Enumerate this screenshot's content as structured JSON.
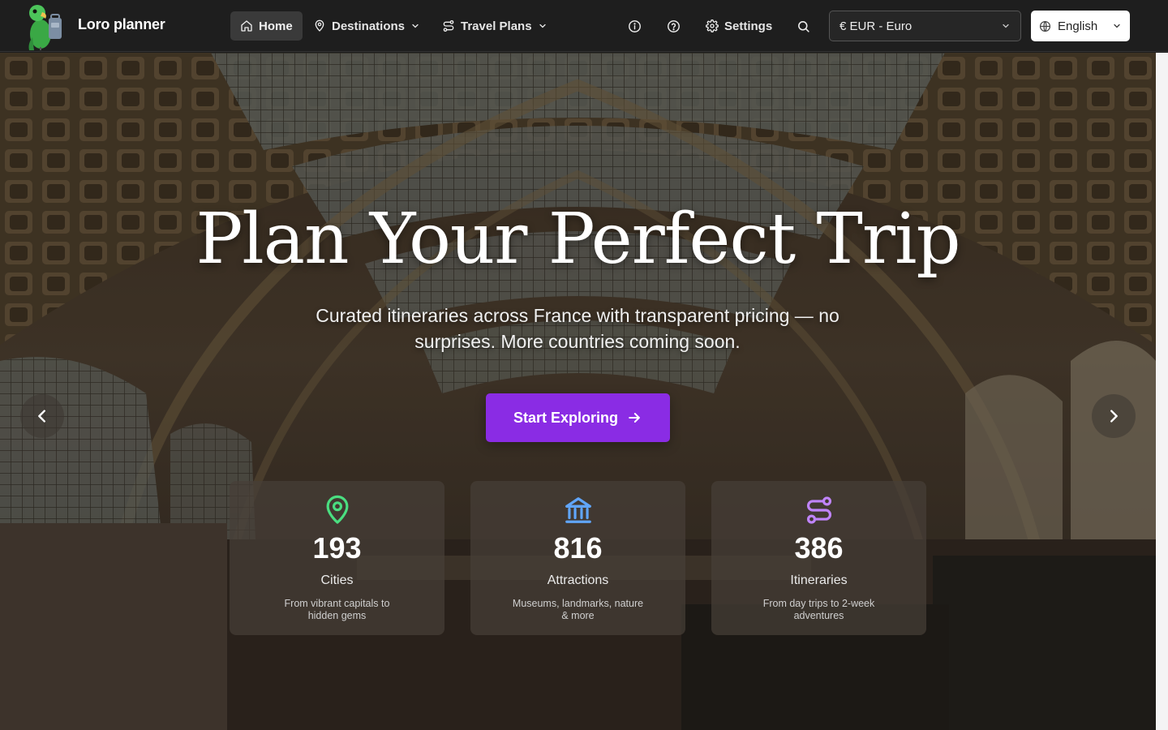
{
  "nav": {
    "brand": "Loro planner",
    "home": "Home",
    "destinations": "Destinations",
    "travel_plans": "Travel Plans",
    "settings": "Settings",
    "currency": "€ EUR - Euro",
    "language": "English"
  },
  "hero": {
    "title": "Plan Your Perfect Trip",
    "subtitle": "Curated itineraries across France with transparent pricing — no surprises. More countries coming soon.",
    "cta": "Start Exploring"
  },
  "stats": [
    {
      "value": "193",
      "label": "Cities",
      "description": "From vibrant capitals to hidden gems",
      "icon": "map-pin-icon",
      "color": "#4ade80"
    },
    {
      "value": "816",
      "label": "Attractions",
      "description": "Museums, landmarks, nature & more",
      "icon": "landmark-icon",
      "color": "#60a5fa"
    },
    {
      "value": "386",
      "label": "Itineraries",
      "description": "From day trips to 2-week adventures",
      "icon": "route-icon",
      "color": "#c084fc"
    }
  ],
  "colors": {
    "accent": "#8a2ce4",
    "nav_bg": "#1e1e1e"
  }
}
